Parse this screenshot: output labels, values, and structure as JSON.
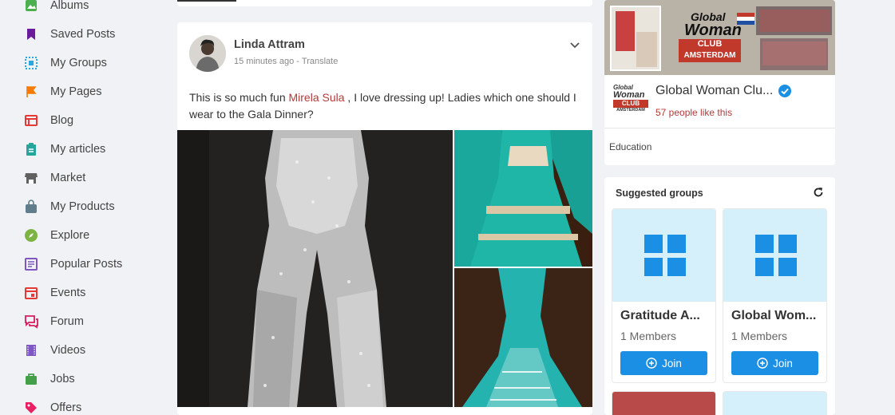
{
  "sidebar": {
    "items": [
      {
        "label": "Albums",
        "icon": "albums-icon",
        "color": "#4caf50"
      },
      {
        "label": "Saved Posts",
        "icon": "bookmark-icon",
        "color": "#6a1b9a"
      },
      {
        "label": "My Groups",
        "icon": "groups-icon",
        "color": "#29a8e0"
      },
      {
        "label": "My Pages",
        "icon": "flag-icon",
        "color": "#f57c00"
      },
      {
        "label": "Blog",
        "icon": "blog-icon",
        "color": "#e53935"
      },
      {
        "label": "My articles",
        "icon": "clipboard-icon",
        "color": "#26a69a"
      },
      {
        "label": "Market",
        "icon": "store-icon",
        "color": "#616161"
      },
      {
        "label": "My Products",
        "icon": "shopping-bag-icon",
        "color": "#607d8b"
      },
      {
        "label": "Explore",
        "icon": "compass-icon",
        "color": "#7cb342"
      },
      {
        "label": "Popular Posts",
        "icon": "popular-posts-icon",
        "color": "#7e57c2"
      },
      {
        "label": "Events",
        "icon": "calendar-icon",
        "color": "#e53935"
      },
      {
        "label": "Forum",
        "icon": "forum-icon",
        "color": "#d81b60"
      },
      {
        "label": "Videos",
        "icon": "film-icon",
        "color": "#7e57c2"
      },
      {
        "label": "Jobs",
        "icon": "briefcase-icon",
        "color": "#43a047"
      },
      {
        "label": "Offers",
        "icon": "tag-icon",
        "color": "#e91e63"
      }
    ]
  },
  "post": {
    "author": "Linda Attram",
    "time": "15 minutes ago",
    "translate": "Translate",
    "text_before": "This is so much fun ",
    "mention": "Mirela Sula",
    "text_after": " , I love dressing up! Ladies which one should I wear to the Gala Dinner?"
  },
  "page_card": {
    "cover_logo_line1": "Global",
    "cover_logo_line2": "Woman",
    "cover_logo_club": "CLUB",
    "cover_logo_city": "AMSTERDAM",
    "name": "Global Woman Clu...",
    "likes": "57 people like this",
    "category": "Education",
    "logo_line1": "Global",
    "logo_line2": "Woman",
    "logo_club": "CLUB",
    "logo_city": "AMSTERDAM"
  },
  "suggested_groups": {
    "title": "Suggested groups",
    "groups": [
      {
        "name": "Gratitude A...",
        "members": "1 Members",
        "join": "Join"
      },
      {
        "name": "Global Wom...",
        "members": "1 Members",
        "join": "Join"
      }
    ]
  },
  "colors": {
    "accent": "#1a8fe3",
    "mention": "#b23a3a",
    "group_placeholder": "#d6f0fb",
    "group_icon": "#1a8fe3"
  }
}
